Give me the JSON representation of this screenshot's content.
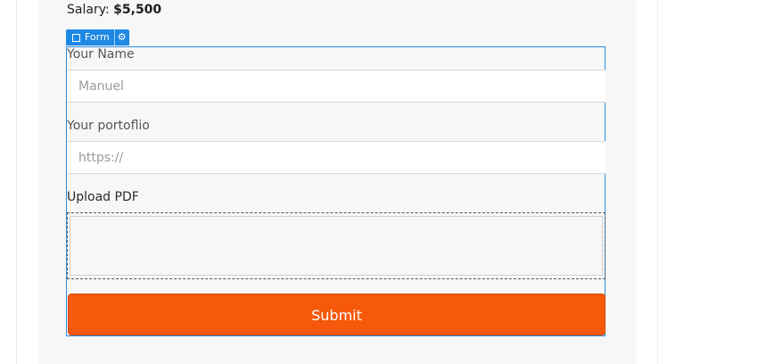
{
  "salary": {
    "label": "Salary:",
    "value": "$5,500"
  },
  "form_tag": {
    "label": "Form",
    "checkbox_icon": "checkbox-square-icon",
    "settings_icon": "gear-icon"
  },
  "form": {
    "name_label": "Your Name",
    "name_value": "Manuel",
    "portfolio_label": "Your portoflio",
    "portfolio_value": "https://",
    "upload_label": "Upload PDF",
    "submit_label": "Submit"
  },
  "colors": {
    "accent": "#1e88e5",
    "submit": "#f7590c"
  }
}
